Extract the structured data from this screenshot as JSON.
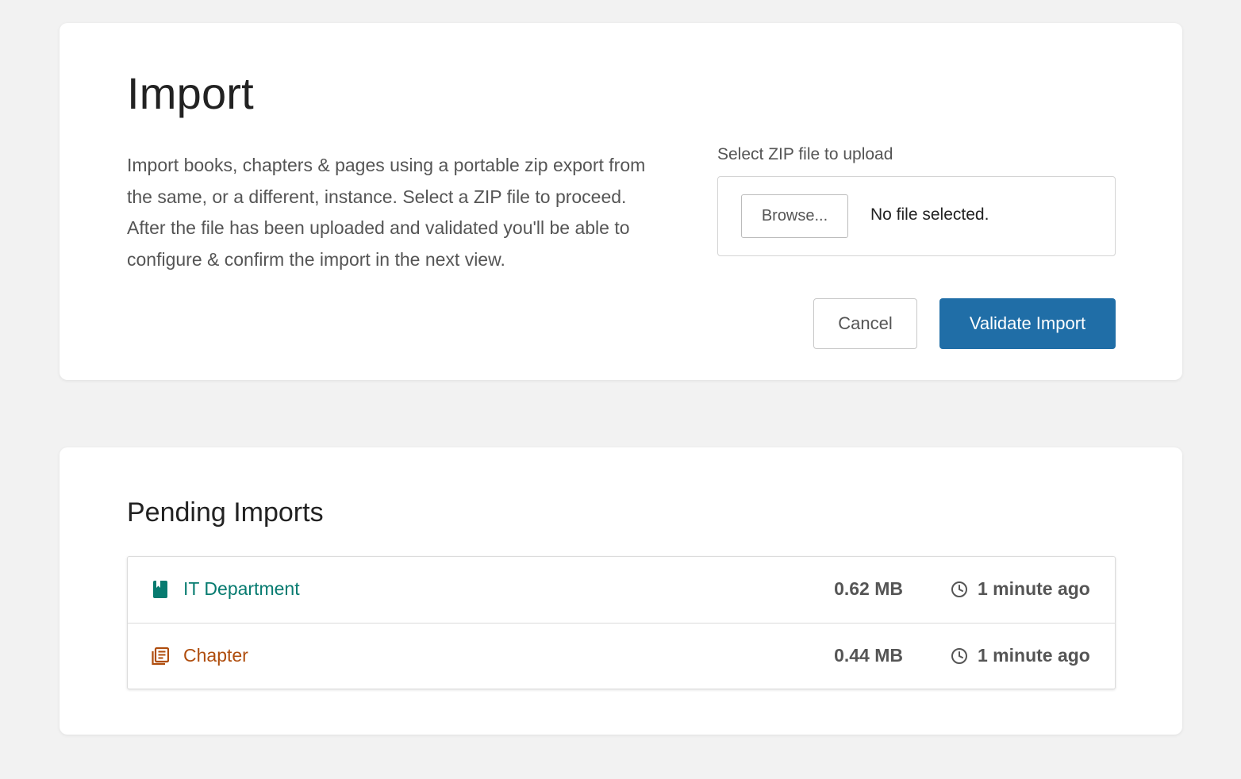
{
  "import_card": {
    "title": "Import",
    "description": "Import books, chapters & pages using a portable zip export from the same, or a different, instance. Select a ZIP file to proceed. After the file has been uploaded and validated you'll be able to configure & confirm the import in the next view.",
    "upload_label": "Select ZIP file to upload",
    "browse_label": "Browse...",
    "file_status": "No file selected.",
    "cancel_label": "Cancel",
    "validate_label": "Validate Import"
  },
  "pending_card": {
    "title": "Pending Imports",
    "items": [
      {
        "name": "IT Department",
        "icon": "book-icon",
        "color": "#077b70",
        "size": "0.62 MB",
        "time": "1 minute ago"
      },
      {
        "name": "Chapter",
        "icon": "chapter-icon",
        "color": "#af4d0d",
        "size": "0.44 MB",
        "time": "1 minute ago"
      }
    ]
  },
  "colors": {
    "primary": "#206ea7",
    "book": "#077b70",
    "chapter": "#af4d0d",
    "background": "#f2f2f2"
  }
}
